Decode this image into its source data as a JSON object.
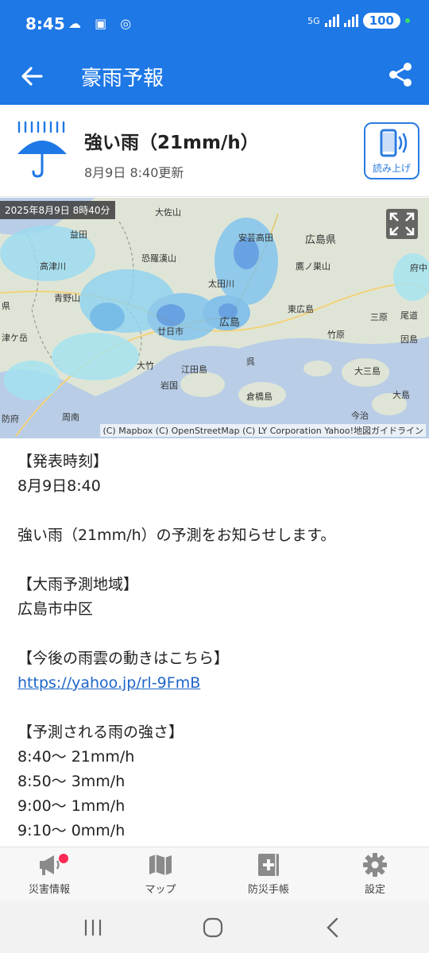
{
  "status_bar": {
    "time": "8:45",
    "network": "5G",
    "battery": "100"
  },
  "app_bar": {
    "title": "豪雨予報",
    "back_icon": "arrow-left-icon",
    "share_icon": "share-icon"
  },
  "header": {
    "title": "強い雨（21mm/h）",
    "updated": "8月9日 8:40更新",
    "read_aloud_label": "読み上げ",
    "icon": "umbrella-rain-icon"
  },
  "map": {
    "timestamp": "2025年8月9日 8時40分",
    "credit": "(C) Mapbox (C) OpenStreetMap (C) LY Corporation Yahoo!地図ガイドライン",
    "places": [
      "大佐山",
      "益田",
      "広島県",
      "安芸高田",
      "恐羅漢山",
      "高津川",
      "青野山",
      "太田川",
      "鷹ノ巣山",
      "府中",
      "東広島",
      "廿日市",
      "広島",
      "三原",
      "尾道",
      "竹原",
      "大竹",
      "呉",
      "江田島",
      "因島",
      "大三島",
      "岩国",
      "倉橋島",
      "大島",
      "周南",
      "防府",
      "今治",
      "県",
      "津ケ岳"
    ]
  },
  "body": {
    "sections": [
      {
        "heading": "【発表時刻】",
        "lines": [
          "8月9日8:40"
        ]
      },
      {
        "heading": "",
        "lines": [
          "強い雨（21mm/h）の予測をお知らせします。"
        ]
      },
      {
        "heading": "【大雨予測地域】",
        "lines": [
          "広島市中区"
        ]
      },
      {
        "heading": "【今後の雨雲の動きはこちら】",
        "link": "https://yahoo.jp/rl-9FmB"
      },
      {
        "heading": "【予測される雨の強さ】",
        "lines": [
          "8:40〜 21mm/h",
          "8:50〜 3mm/h",
          "9:00〜 1mm/h",
          "9:10〜 0mm/h"
        ]
      }
    ]
  },
  "bottom_nav": [
    {
      "label": "災害情報",
      "icon": "megaphone-icon"
    },
    {
      "label": "マップ",
      "icon": "map-icon"
    },
    {
      "label": "防災手帳",
      "icon": "first-aid-book-icon"
    },
    {
      "label": "設定",
      "icon": "gear-icon"
    }
  ],
  "colors": {
    "primary": "#1e78e6",
    "link": "#2066c8",
    "badge": "#ff2a55"
  }
}
